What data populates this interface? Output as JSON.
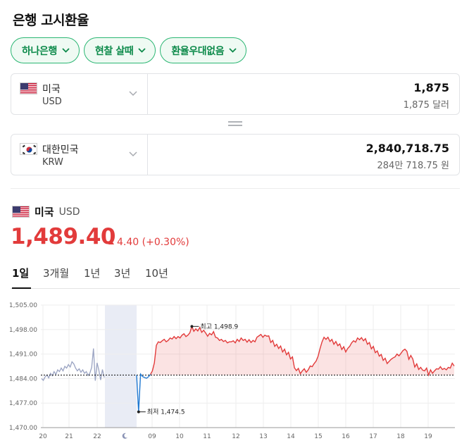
{
  "header": {
    "title": "은행 고시환율"
  },
  "filters": [
    {
      "label": "하나은행"
    },
    {
      "label": "현찰 살때"
    },
    {
      "label": "환율우대없음"
    }
  ],
  "from": {
    "name": "미국",
    "code": "USD",
    "amount": "1,875",
    "amount_text": "1,875 달러",
    "flag": "us-flag"
  },
  "to": {
    "name": "대한민국",
    "code": "KRW",
    "amount": "2,840,718.75",
    "amount_text": "284만 718.75 원",
    "flag": "kr-flag"
  },
  "currency": {
    "name": "미국",
    "code": "USD",
    "rate": "1,489.40",
    "change": "4.40 (+0.30%)",
    "trend": "up"
  },
  "tabs": [
    {
      "label": "1일",
      "active": true
    },
    {
      "label": "3개월",
      "active": false
    },
    {
      "label": "1년",
      "active": false
    },
    {
      "label": "3년",
      "active": false
    },
    {
      "label": "10년",
      "active": false
    }
  ],
  "colors": {
    "accent_green": "#2bb673",
    "up_red": "#e23b3b",
    "down_blue": "#1f78d1",
    "previous_gray": "#9aa3c2"
  },
  "chart_data": {
    "type": "line",
    "y_ticks": [
      "1,505.00",
      "1,498.00",
      "1,491.00",
      "1,484.00",
      "1,477.00",
      "1,470.00"
    ],
    "ylim": [
      1470,
      1505
    ],
    "x_ticks": [
      "20",
      "21",
      "22",
      "moon-icon",
      "09",
      "10",
      "11",
      "12",
      "13",
      "14",
      "15",
      "16",
      "17",
      "18",
      "19"
    ],
    "baseline": 1485.0,
    "high_label": "최고 1,498.9",
    "low_label": "최저 1,474.5",
    "series": [
      {
        "segment": "previous-day",
        "values": [
          1484,
          1483.5,
          1484.5,
          1485,
          1484.2,
          1485.5,
          1484.8,
          1486,
          1485.2,
          1486.5,
          1486,
          1487,
          1486.2,
          1487.5,
          1487,
          1488,
          1487.3,
          1488.8,
          1488.2,
          1487,
          1486.2,
          1486.8,
          1485.8,
          1486.5,
          1485.5,
          1486,
          1484.9,
          1485.6,
          1487.2,
          1492.6,
          1483.4,
          1488.5,
          1486.4,
          1483.6,
          1486.6,
          1484.3
        ]
      },
      {
        "segment": "today",
        "values": [
          1485,
          1474.5,
          1485.3,
          1484.6,
          1484.3,
          1484.1,
          1484.5,
          1485.2,
          1486.2,
          1488.5,
          1493.5,
          1494.5,
          1494.3,
          1494.8,
          1495.2,
          1494.5,
          1494.9,
          1495.6,
          1495.3,
          1496,
          1495.4,
          1496,
          1495.6,
          1496.4,
          1496.8,
          1496,
          1496.4,
          1497.1,
          1498.9,
          1497.5,
          1498.2,
          1497.6,
          1498.6,
          1497.2,
          1497.8,
          1497,
          1496.1,
          1496.9,
          1496.5,
          1497.4,
          1495.8,
          1495.6,
          1494.9,
          1495.2,
          1494.6,
          1494.9,
          1494.2,
          1494.5,
          1494.5,
          1494.8,
          1494.2,
          1495.2,
          1494.6,
          1495.6,
          1494.9,
          1495.2,
          1494.4,
          1495.1,
          1494.3,
          1494.9,
          1494.5,
          1495.8,
          1496.2,
          1496.6,
          1495.8,
          1496.4,
          1496.1,
          1496.2,
          1494.3,
          1494.9,
          1493.2,
          1493.8,
          1492.6,
          1493.3,
          1491.6,
          1492.4,
          1490.8,
          1491.5,
          1489.6,
          1490.2,
          1487.1,
          1486.3,
          1486.9,
          1485.4,
          1486.2,
          1486.8,
          1485.8,
          1486.5,
          1487.6,
          1487.4,
          1488.3,
          1489,
          1490.4,
          1492.6,
          1494.5,
          1495.8,
          1495.2,
          1495.8,
          1494.6,
          1495.2,
          1493.8,
          1494.6,
          1493.4,
          1493.9,
          1492.3,
          1493.1,
          1491.6,
          1492.6,
          1493.2,
          1494.2,
          1494.8,
          1494.4,
          1495.6,
          1495.1,
          1495.7,
          1494.8,
          1495.4,
          1493.8,
          1494.3,
          1492.5,
          1493.2,
          1491.4,
          1491.9,
          1490.4,
          1490.9,
          1489.2,
          1489.8,
          1488.3,
          1488.9,
          1489.5,
          1489.9,
          1490.2,
          1491,
          1490.5,
          1491.2,
          1492,
          1492.4,
          1491.8,
          1489.5,
          1490.6,
          1489.6,
          1487.3,
          1488.2,
          1486.6,
          1487.2,
          1486.4,
          1486.2,
          1487,
          1485,
          1486.5,
          1485.5,
          1486.2,
          1486.8,
          1486.7,
          1487.4,
          1486.6,
          1486.9,
          1486.5,
          1487.2,
          1487,
          1488.4,
          1487.6
        ]
      }
    ]
  }
}
